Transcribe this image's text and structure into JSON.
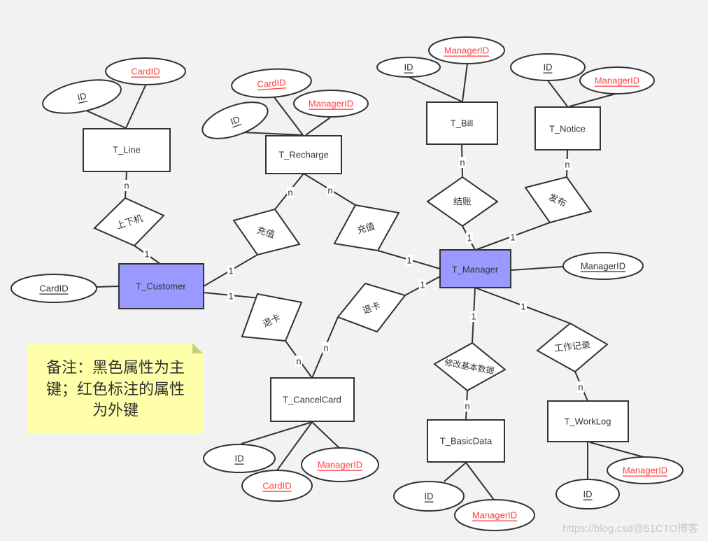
{
  "colors": {
    "background": "#f2f2f2",
    "highlight_entity": "#9999ff",
    "foreign_key": "#ff4040",
    "note_fill": "#ffffaa"
  },
  "entities": {
    "line": "T_Line",
    "recharge": "T_Recharge",
    "bill": "T_Bill",
    "notice": "T_Notice",
    "customer": "T_Customer",
    "manager": "T_Manager",
    "cancelcard": "T_CancelCard",
    "basicdata": "T_BasicData",
    "worklog": "T_WorkLog"
  },
  "attributes": {
    "line": {
      "id": "ID",
      "cardid": "CardID"
    },
    "recharge": {
      "id": "ID",
      "cardid": "CardID",
      "managerid": "ManagerID"
    },
    "bill": {
      "id": "ID",
      "managerid": "ManagerID"
    },
    "notice": {
      "id": "ID",
      "managerid": "ManagerID"
    },
    "customer": {
      "cardid": "CardID"
    },
    "manager": {
      "managerid": "ManagerID"
    },
    "cancelcard": {
      "id": "ID",
      "cardid": "CardID",
      "managerid": "ManagerID"
    },
    "basicdata": {
      "id": "ID",
      "managerid": "ManagerID"
    },
    "worklog": {
      "id": "ID",
      "managerid": "ManagerID"
    }
  },
  "relationships": {
    "online": "上下机",
    "recharge_customer": "充值",
    "recharge_manager": "充值",
    "cancel_customer": "退卡",
    "cancel_manager": "退卡",
    "checkout": "结账",
    "publish": "发布",
    "modify_basic": "修改基本数据",
    "worklog": "工作记录"
  },
  "cardinality": {
    "one": "1",
    "many": "n"
  },
  "note": {
    "lines": [
      "备注：黑色属性为主",
      "键；红色标注的属性",
      "为外键"
    ]
  },
  "watermark": "https://blog.csd@51CTO博客"
}
